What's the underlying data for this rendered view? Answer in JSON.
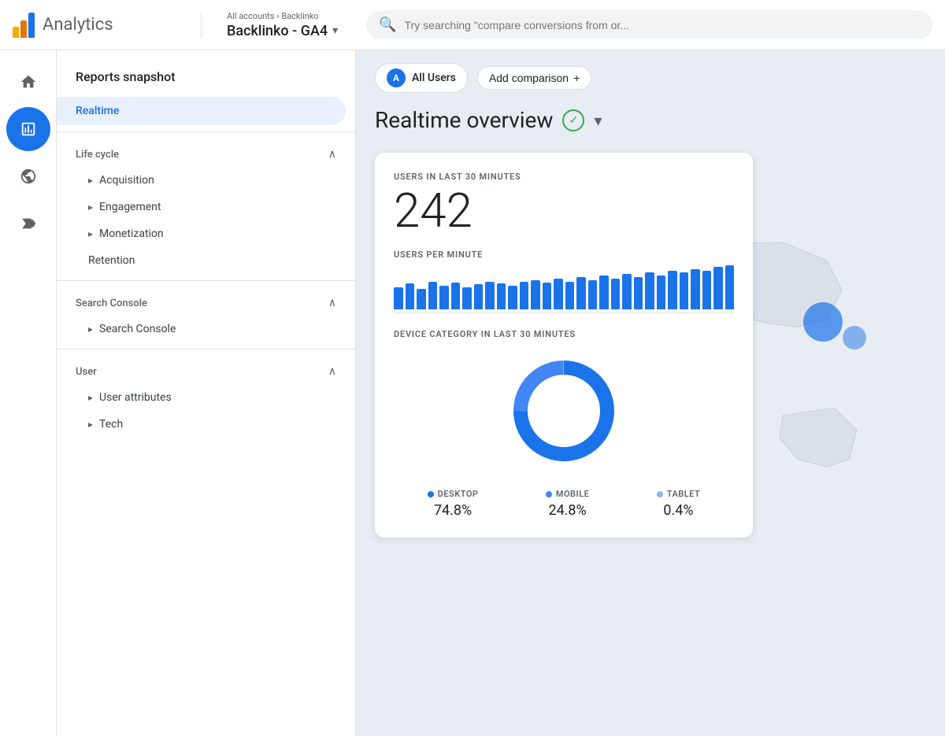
{
  "topbar": {
    "app_name": "Analytics",
    "breadcrumb": "All accounts > Backlinko",
    "breadcrumb_part1": "All accounts",
    "breadcrumb_separator": ">",
    "breadcrumb_part2": "Backlinko",
    "property_name": "Backlinko - GA4",
    "search_placeholder": "Try searching \"compare conversions from or..."
  },
  "nav_icons": [
    {
      "id": "home",
      "icon": "⌂",
      "active": false
    },
    {
      "id": "reports",
      "icon": "📊",
      "active": true
    },
    {
      "id": "explore",
      "icon": "⊙",
      "active": false
    },
    {
      "id": "advertising",
      "icon": "⊕",
      "active": false
    }
  ],
  "sidebar": {
    "title": "Reports snapshot",
    "items": [
      {
        "id": "realtime",
        "label": "Realtime",
        "active": true
      }
    ],
    "sections": [
      {
        "id": "life-cycle",
        "label": "Life cycle",
        "expanded": true,
        "items": [
          {
            "id": "acquisition",
            "label": "Acquisition"
          },
          {
            "id": "engagement",
            "label": "Engagement"
          },
          {
            "id": "monetization",
            "label": "Monetization"
          },
          {
            "id": "retention",
            "label": "Retention"
          }
        ]
      },
      {
        "id": "search-console",
        "label": "Search Console",
        "expanded": true,
        "items": [
          {
            "id": "search-console-item",
            "label": "Search Console"
          }
        ]
      },
      {
        "id": "user",
        "label": "User",
        "expanded": true,
        "items": [
          {
            "id": "user-attributes",
            "label": "User attributes"
          },
          {
            "id": "tech",
            "label": "Tech"
          }
        ]
      }
    ]
  },
  "content": {
    "all_users_label": "All Users",
    "all_users_avatar": "A",
    "add_comparison_label": "Add comparison",
    "add_comparison_icon": "+",
    "page_title": "Realtime overview",
    "users_in_30_label": "USERS IN LAST 30 MINUTES",
    "users_count": "242",
    "users_per_minute_label": "USERS PER MINUTE",
    "device_category_label": "DEVICE CATEGORY IN LAST 30 MINUTES",
    "device_legend": [
      {
        "id": "desktop",
        "label": "DESKTOP",
        "value": "74.8%",
        "color": "#1a73e8"
      },
      {
        "id": "mobile",
        "label": "MOBILE",
        "value": "24.8%",
        "color": "#4285f4"
      },
      {
        "id": "tablet",
        "label": "TABLET",
        "value": "0.4%",
        "color": "#8ab4f8"
      }
    ],
    "bar_chart_heights": [
      30,
      35,
      28,
      38,
      32,
      36,
      30,
      34,
      38,
      35,
      32,
      38,
      40,
      36,
      42,
      38,
      44,
      40,
      46,
      42,
      48,
      44,
      50,
      46,
      52,
      50,
      55,
      52,
      58,
      60
    ]
  }
}
